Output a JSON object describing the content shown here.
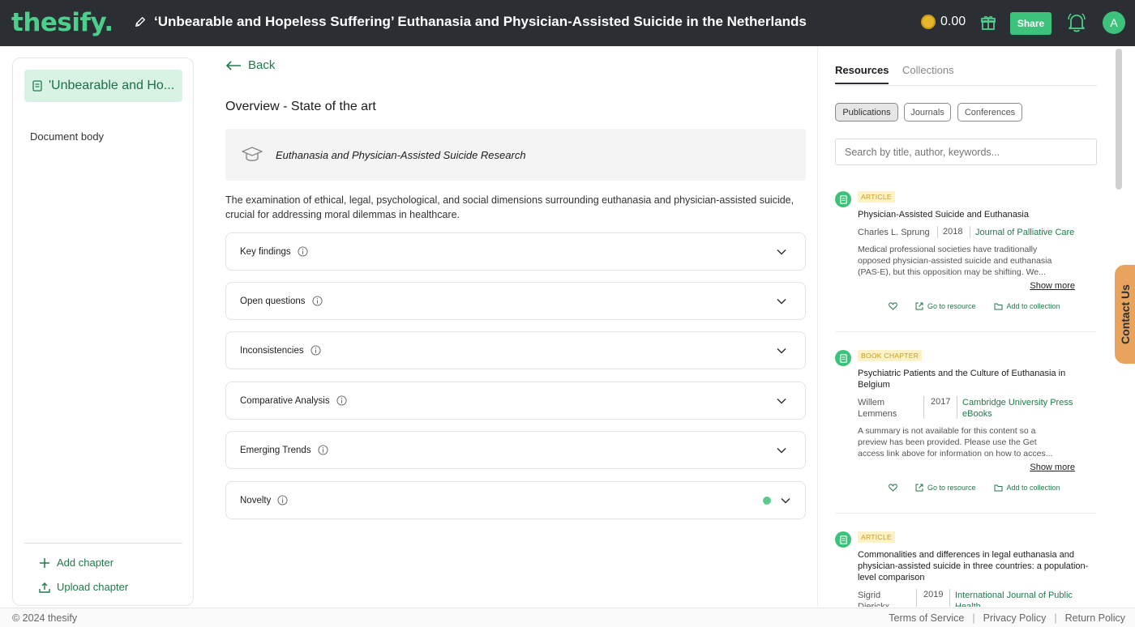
{
  "header": {
    "logo": "thesify.",
    "doc_title": "‘Unbearable and Hopeless Suffering’ Euthanasia and Physician-Assisted Suicide in the Netherlands",
    "credits": "0.00",
    "share_label": "Share",
    "avatar_initial": "A"
  },
  "sidebar": {
    "chapter_label": "'Unbearable and Ho...",
    "doc_body_label": "Document body",
    "add_chapter": "Add chapter",
    "upload_chapter": "Upload chapter"
  },
  "main": {
    "back_label": "Back",
    "section_title": "Overview - State of the art",
    "topic": "Euthanasia and Physician-Assisted Suicide Research",
    "description": "The examination of ethical, legal, psychological, and social dimensions surrounding euthanasia and physician-assisted suicide, crucial for addressing moral dilemmas in healthcare.",
    "accordions": [
      {
        "label": "Key findings"
      },
      {
        "label": "Open questions"
      },
      {
        "label": "Inconsistencies"
      },
      {
        "label": "Comparative Analysis"
      },
      {
        "label": "Emerging Trends"
      },
      {
        "label": "Novelty"
      }
    ]
  },
  "resources": {
    "tabs": [
      "Resources",
      "Collections"
    ],
    "filters": [
      "Publications",
      "Journals",
      "Conferences"
    ],
    "search_placeholder": "Search by title, author, keywords...",
    "go_to_resource": "Go to resource",
    "add_to_collection": "Add to collection",
    "show_more": "Show more",
    "items": [
      {
        "type": "ARTICLE",
        "title": "Physician-Assisted Suicide and Euthanasia",
        "author": "Charles L. Sprung",
        "year": "2018",
        "journal": "Journal of Palliative Care",
        "abstract": "Medical professional societies have traditionally opposed physician-assisted suicide and euthanasia (PAS-E), but this opposition may be shifting. We..."
      },
      {
        "type": "BOOK CHAPTER",
        "title": "Psychiatric Patients and the Culture of Euthanasia in Belgium",
        "author": "Willem Lemmens",
        "year": "2017",
        "journal": "Cambridge University Press eBooks",
        "abstract": "A summary is not available for this content so a preview has been provided. Please use the Get access link above for information on how to acces..."
      },
      {
        "type": "ARTICLE",
        "title": "Commonalities and differences in legal euthanasia and physician-assisted suicide in three countries: a population-level comparison",
        "author": "Sigrid Dierickx",
        "year": "2019",
        "journal": "International Journal of Public Health",
        "abstract": ""
      }
    ]
  },
  "contact_label": "Contact Us",
  "footer": {
    "copyright": "© 2024 thesify",
    "links": [
      "Terms of Service",
      "Privacy Policy",
      "Return Policy"
    ]
  },
  "colors": {
    "brand_green": "#3cc27a",
    "header_bg": "#2b2f33",
    "link_green": "#1f7a4a",
    "contact_orange": "#e8a35d"
  }
}
